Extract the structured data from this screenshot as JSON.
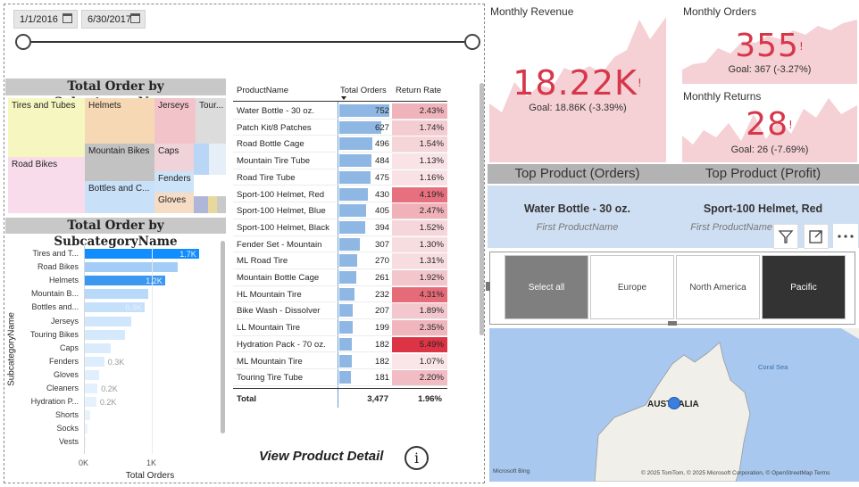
{
  "date_slicer": {
    "start": "1/1/2016",
    "end": "6/30/2017"
  },
  "treemap": {
    "title": "Total Order by SubcategoryName",
    "tiles": [
      "Tires and Tubes",
      "Helmets",
      "Jerseys",
      "Tour...",
      "Road Bikes",
      "Mountain Bikes",
      "Caps",
      "Bottles and C...",
      "Fenders",
      "Gloves"
    ]
  },
  "bar_chart": {
    "title": "Total Order by SubcategoryName",
    "y_axis_label": "SubcategoryName",
    "x_axis_label": "Total Orders",
    "x_ticks": [
      "0K",
      "1K"
    ],
    "rows": [
      {
        "label": "Tires and T...",
        "value": 1700,
        "data_label": "1.7K",
        "color": "#118dff"
      },
      {
        "label": "Road Bikes",
        "value": 1380,
        "data_label": "",
        "color": "#a3cdf7"
      },
      {
        "label": "Helmets",
        "value": 1200,
        "data_label": "1.2K",
        "color": "#3a98f0"
      },
      {
        "label": "Mountain B...",
        "value": 950,
        "data_label": "",
        "color": "#b8d9fa"
      },
      {
        "label": "Bottles and...",
        "value": 900,
        "data_label": "0.9K",
        "color": "#c4e0fb"
      },
      {
        "label": "Jerseys",
        "value": 700,
        "data_label": "",
        "color": "#cfe6fc"
      },
      {
        "label": "Touring Bikes",
        "value": 600,
        "data_label": "",
        "color": "#d5e9fc"
      },
      {
        "label": "Caps",
        "value": 400,
        "data_label": "",
        "color": "#daebfc"
      },
      {
        "label": "Fenders",
        "value": 300,
        "data_label": "0.3K",
        "color": "#dcedfd"
      },
      {
        "label": "Gloves",
        "value": 230,
        "data_label": "",
        "color": "#e0effd"
      },
      {
        "label": "Cleaners",
        "value": 200,
        "data_label": "0.2K",
        "color": "#e3f0fd"
      },
      {
        "label": "Hydration P...",
        "value": 182,
        "data_label": "0.2K",
        "color": "#e5f1fd"
      },
      {
        "label": "Shorts",
        "value": 90,
        "data_label": "",
        "color": "#e8f2fd"
      },
      {
        "label": "Socks",
        "value": 50,
        "data_label": "",
        "color": "#ebf4fe"
      },
      {
        "label": "Vests",
        "value": 30,
        "data_label": "",
        "color": "#eef5fe"
      }
    ]
  },
  "table": {
    "headers": [
      "ProductName",
      "Total Orders",
      "Return Rate"
    ],
    "rows": [
      {
        "name": "Water Bottle - 30 oz.",
        "orders": "752",
        "orders_value": 752,
        "rate": "2.43%",
        "rate_color": "#f0b3bb"
      },
      {
        "name": "Patch Kit/8 Patches",
        "orders": "627",
        "orders_value": 627,
        "rate": "1.74%",
        "rate_color": "#f4cdd2"
      },
      {
        "name": "Road Bottle Cage",
        "orders": "496",
        "orders_value": 496,
        "rate": "1.54%",
        "rate_color": "#f6d5d9"
      },
      {
        "name": "Mountain Tire Tube",
        "orders": "484",
        "orders_value": 484,
        "rate": "1.13%",
        "rate_color": "#f9e3e6"
      },
      {
        "name": "Road Tire Tube",
        "orders": "475",
        "orders_value": 475,
        "rate": "1.16%",
        "rate_color": "#f9e2e5"
      },
      {
        "name": "Sport-100 Helmet, Red",
        "orders": "430",
        "orders_value": 430,
        "rate": "4.19%",
        "rate_color": "#e7707e"
      },
      {
        "name": "Sport-100 Helmet, Blue",
        "orders": "405",
        "orders_value": 405,
        "rate": "2.47%",
        "rate_color": "#f0b1b9"
      },
      {
        "name": "Sport-100 Helmet, Black",
        "orders": "394",
        "orders_value": 394,
        "rate": "1.52%",
        "rate_color": "#f6d6da"
      },
      {
        "name": "Fender Set - Mountain",
        "orders": "307",
        "orders_value": 307,
        "rate": "1.30%",
        "rate_color": "#f8dde0"
      },
      {
        "name": "ML Road Tire",
        "orders": "270",
        "orders_value": 270,
        "rate": "1.31%",
        "rate_color": "#f8dde0"
      },
      {
        "name": "Mountain Bottle Cage",
        "orders": "261",
        "orders_value": 261,
        "rate": "1.92%",
        "rate_color": "#f3c6cc"
      },
      {
        "name": "HL Mountain Tire",
        "orders": "232",
        "orders_value": 232,
        "rate": "4.31%",
        "rate_color": "#e66b79"
      },
      {
        "name": "Bike Wash - Dissolver",
        "orders": "207",
        "orders_value": 207,
        "rate": "1.89%",
        "rate_color": "#f3c7cd"
      },
      {
        "name": "LL Mountain Tire",
        "orders": "199",
        "orders_value": 199,
        "rate": "2.35%",
        "rate_color": "#f0b6be"
      },
      {
        "name": "Hydration Pack - 70 oz.",
        "orders": "182",
        "orders_value": 182,
        "rate": "5.49%",
        "rate_color": "#dc3445"
      },
      {
        "name": "ML Mountain Tire",
        "orders": "182",
        "orders_value": 182,
        "rate": "1.07%",
        "rate_color": "#fae5e8"
      },
      {
        "name": "Touring Tire Tube",
        "orders": "181",
        "orders_value": 181,
        "rate": "2.20%",
        "rate_color": "#f1bcc3"
      }
    ],
    "total": {
      "label": "Total",
      "orders": "3,477",
      "rate": "1.96%"
    }
  },
  "view_detail": {
    "label": "View Product Detail",
    "icon": "info-icon"
  },
  "kpi": {
    "revenue": {
      "title": "Monthly Revenue",
      "value": "18.22K",
      "mark": "!",
      "goal": "Goal: 18.86K (-3.39%)"
    },
    "orders": {
      "title": "Monthly Orders",
      "value": "355",
      "mark": "!",
      "goal": "Goal: 367 (-3.27%)"
    },
    "returns": {
      "title": "Monthly Returns",
      "value": "28",
      "mark": "!",
      "goal": "Goal: 26 (-7.69%)"
    }
  },
  "top_product": {
    "orders": {
      "header": "Top Product (Orders)",
      "name": "Water Bottle - 30 oz.",
      "sub": "First ProductName"
    },
    "profit": {
      "header": "Top Product (Profit)",
      "name": "Sport-100 Helmet, Red",
      "sub": "First ProductName"
    }
  },
  "region_slicer": {
    "buttons": [
      {
        "label": "Select all",
        "selected": true
      },
      {
        "label": "Europe",
        "selected": false
      },
      {
        "label": "North America",
        "selected": false
      },
      {
        "label": "Pacific",
        "selected": true
      }
    ]
  },
  "map": {
    "country": "AUSTRALIA",
    "sea": "Coral Sea",
    "attribution": "© 2025 TomTom, © 2025 Microsoft Corporation, © OpenStreetMap Terms",
    "brand": "Microsoft Bing"
  },
  "colors": {
    "accent_red": "#d6374a",
    "kpi_area": "#f5d0d5",
    "selected_dark": "#333333",
    "selected_gray": "#7f7f7f"
  }
}
